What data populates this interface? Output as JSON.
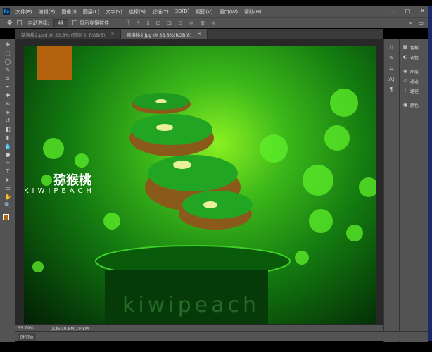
{
  "app": {
    "logo": "Ps"
  },
  "menu": [
    "文件(F)",
    "编辑(E)",
    "图像(I)",
    "图层(L)",
    "文字(Y)",
    "选择(S)",
    "滤镜(T)",
    "3D(D)",
    "视图(V)",
    "窗口(W)",
    "帮助(H)"
  ],
  "window_controls": [
    "—",
    "□",
    "✕"
  ],
  "options": {
    "auto_select_label": "自动选择:",
    "auto_select_value": "组",
    "show_transform_label": "显示变换控件"
  },
  "tabs": [
    {
      "label": "猕猴桃2.psd @ 33.8% (图层 3, RGB/8)",
      "close": "×",
      "active": false
    },
    {
      "label": "猕猴桃2.jpg @ 33.8%(RGB/8)",
      "close": "×",
      "active": true
    }
  ],
  "tools": [
    "move-icon",
    "marquee-icon",
    "lasso-icon",
    "quick-select-icon",
    "crop-icon",
    "eyedropper-icon",
    "healing-icon",
    "brush-icon",
    "stamp-icon",
    "history-brush-icon",
    "eraser-icon",
    "gradient-icon",
    "blur-icon",
    "dodge-icon",
    "pen-icon",
    "type-icon",
    "path-select-icon",
    "shape-icon",
    "hand-icon",
    "zoom-icon"
  ],
  "tool_glyphs": [
    "✥",
    "⬚",
    "◯",
    "✎",
    "⌗",
    "✒",
    "✚",
    "✍",
    "⎈",
    "↺",
    "◧",
    "▮",
    "💧",
    "●",
    "✑",
    "T",
    "➤",
    "▭",
    "✋",
    "🔍"
  ],
  "panels": [
    {
      "label": "色板",
      "icon": "▦"
    },
    {
      "label": "调整",
      "icon": "◐"
    },
    {
      "label": "图层",
      "icon": "◈"
    },
    {
      "label": "通道",
      "icon": "♲"
    },
    {
      "label": "路径",
      "icon": "⌇"
    },
    {
      "label": "颜色",
      "icon": "◉"
    }
  ],
  "canvas": {
    "title": "猕猴桃",
    "subtitle": "KIWIPEACH",
    "bottom_text": "kiwipeach",
    "accent": "#b5620f"
  },
  "status": {
    "zoom": "33.79%",
    "doc": "文档:19.8M/19.8M"
  },
  "timeline": {
    "label": "时间轴"
  },
  "colors": {
    "foreground": "#b5620f",
    "background": "#ffffff"
  }
}
